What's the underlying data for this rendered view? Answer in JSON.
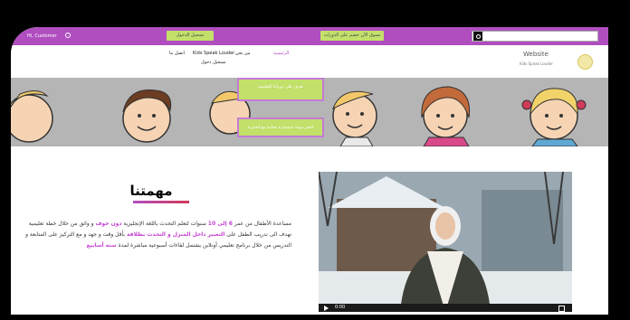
{
  "topbar": {
    "left_label": "Hi, Customer",
    "btn_left": "تسجيل الدخول",
    "btn_center": "تسوق الآن خصم على الدورات",
    "search_placeholder": ""
  },
  "nav": {
    "items": [
      "الرئيسية",
      "من نحن",
      "Kids Speak Louder",
      "اتصل بنا",
      "تسجيل دخول"
    ],
    "logo_title": "Website",
    "logo_sub": "Kids Speak Louder"
  },
  "hero": {
    "btn1": "تعرف على دوراتنا التعليمية",
    "btn2": "احجز موعد استشارة مجانية مع الخبيرة"
  },
  "mission": {
    "title": "مهمتنا",
    "paragraph_parts": [
      {
        "text": "مساعدة الأطفال من عمر ",
        "hl": false
      },
      {
        "text": "6 إلى 10",
        "hl": true
      },
      {
        "text": " سنوات لتعلم التحدث باللغة الإنجليزية ",
        "hl": false
      },
      {
        "text": "دون خوف",
        "hl": true
      },
      {
        "text": " و واثق من خلال خطة تعليمية تهدف الى تدريب الطفل على ",
        "hl": false
      },
      {
        "text": "التعبير داخل المنزل و التحدث بطلاقة",
        "hl": true
      },
      {
        "text": " بأقل وقت و جهد و مع التركيز على المتابعة و التدريس من خلال برنامج تعليمي أونلاين يشتمل لقاءات أسبوعية مباشرة لمدة ",
        "hl": false
      },
      {
        "text": "ستة أسابيع",
        "hl": true
      }
    ]
  },
  "video": {
    "time": "0:00"
  },
  "colors": {
    "brand_purple": "#b04ec0",
    "accent_green": "#c2e06a",
    "highlight": "#c543d3"
  }
}
